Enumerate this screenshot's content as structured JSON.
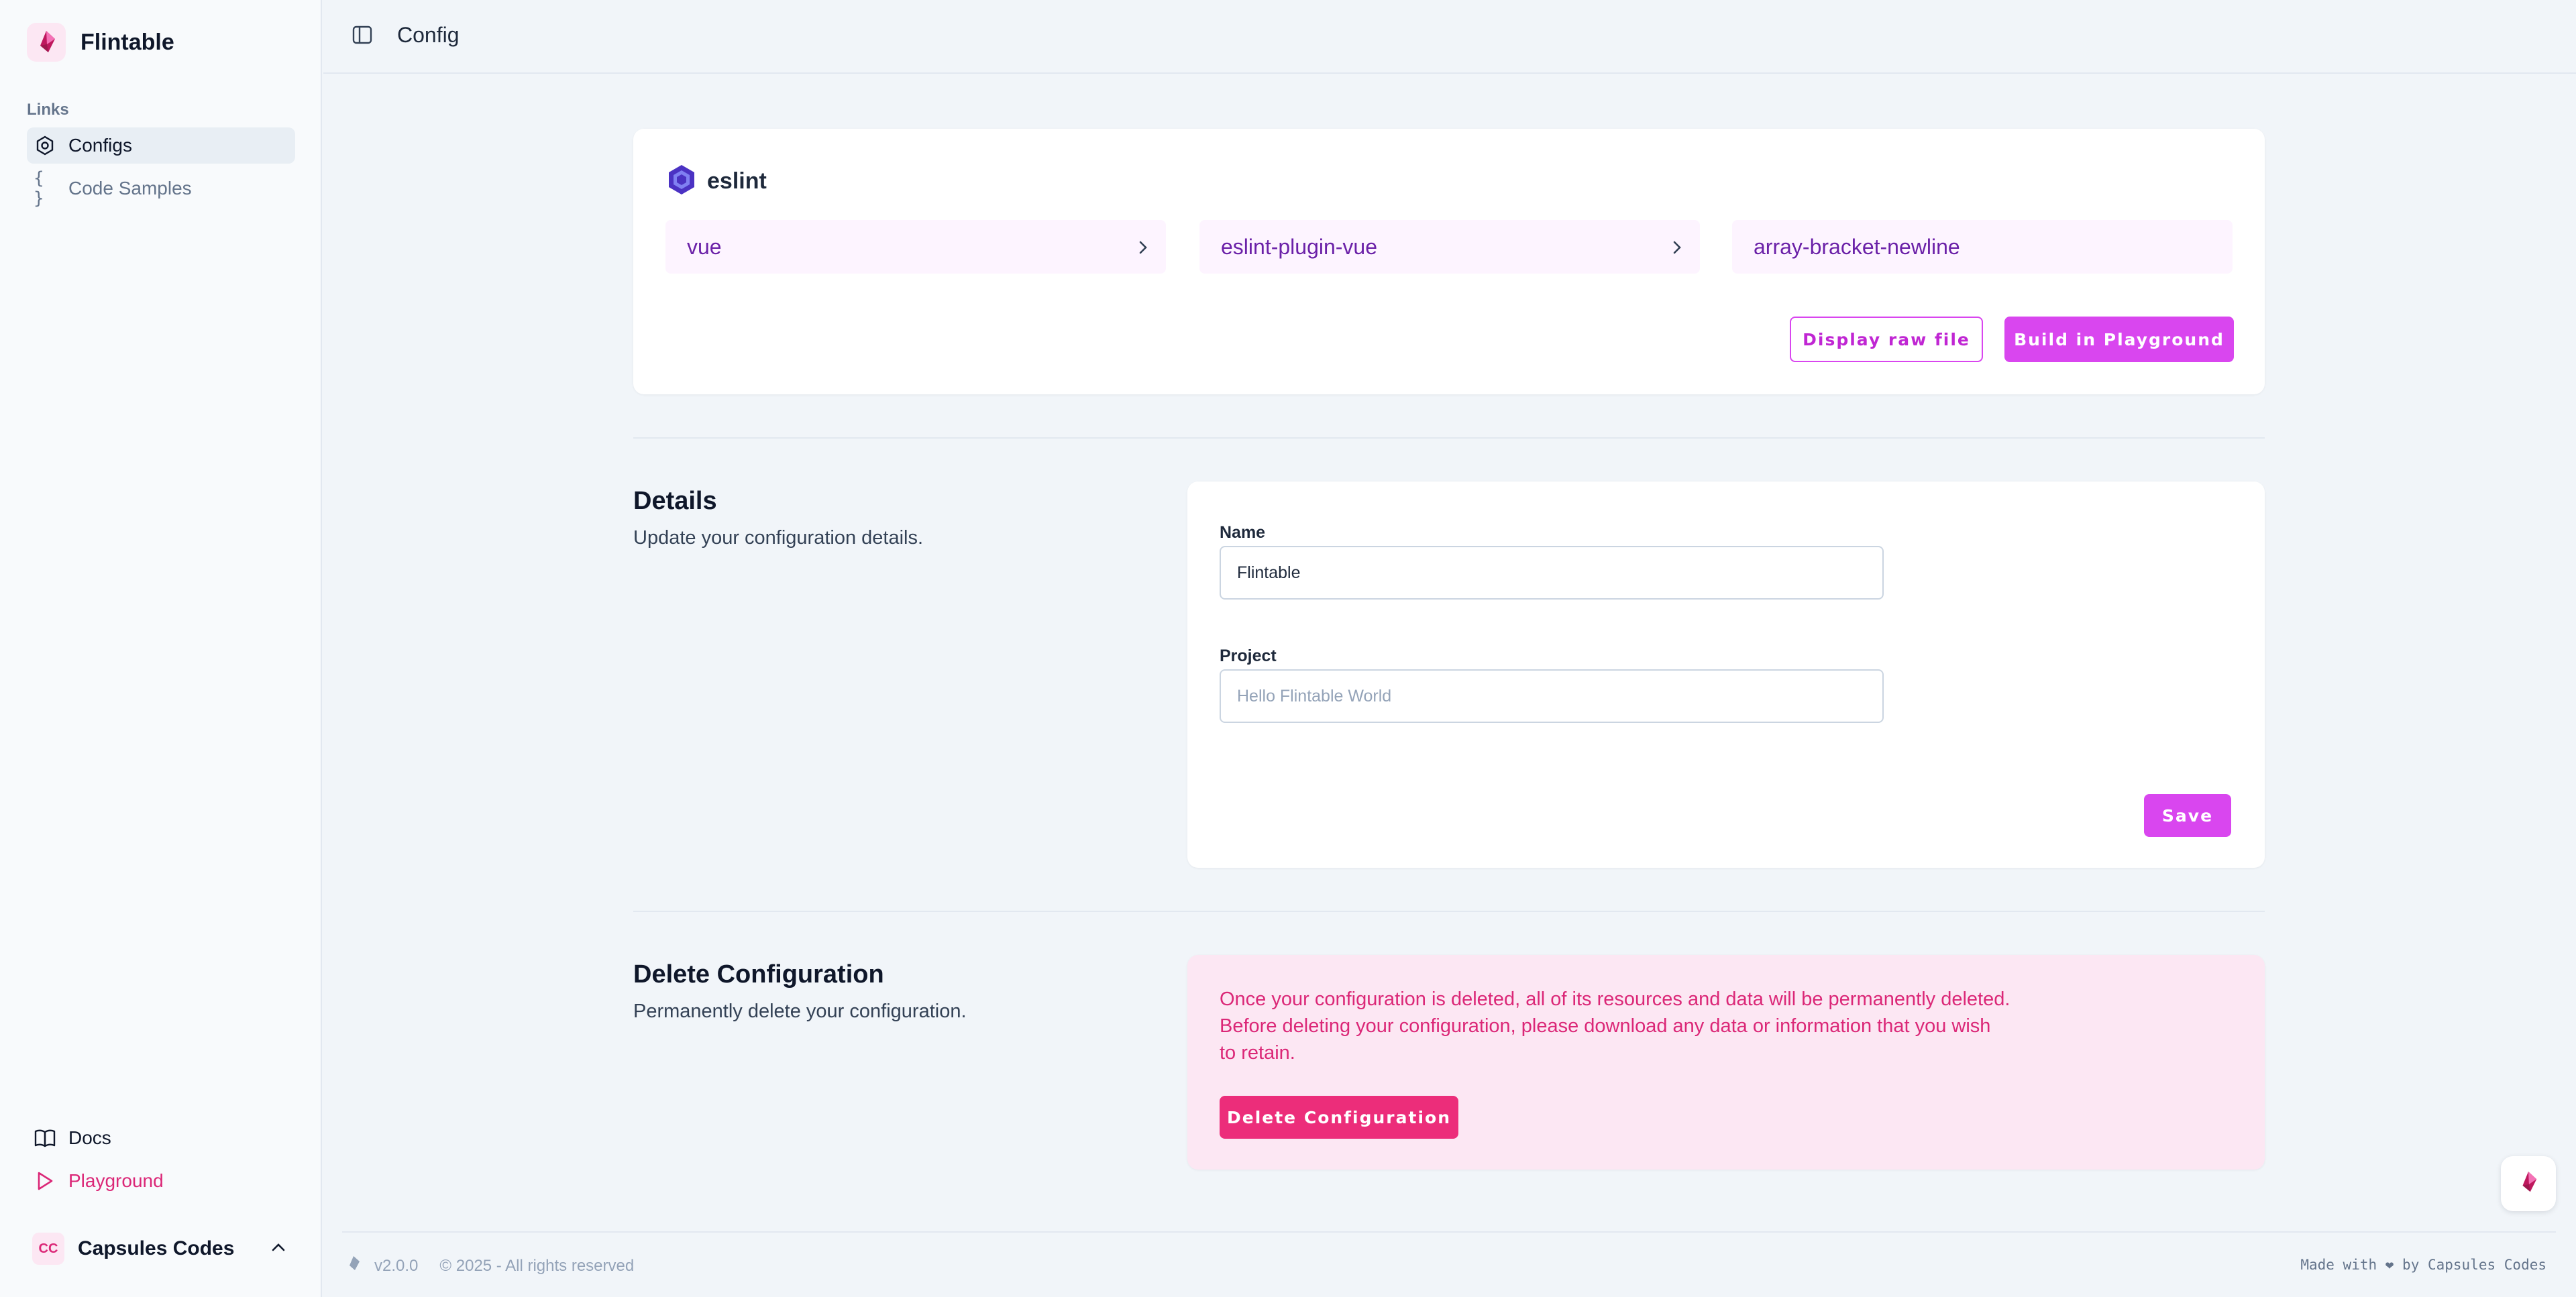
{
  "app": {
    "name": "Flintable"
  },
  "sidebar": {
    "links_label": "Links",
    "items": [
      {
        "label": "Configs",
        "icon": "hexagon-gear-icon",
        "active": true
      },
      {
        "label": "Code Samples",
        "icon": "braces-icon",
        "active": false
      }
    ],
    "bottom_items": [
      {
        "label": "Docs",
        "icon": "book-icon"
      },
      {
        "label": "Playground",
        "icon": "play-icon"
      }
    ],
    "user": {
      "initials": "CC",
      "name": "Capsules Codes"
    }
  },
  "header": {
    "title": "Config"
  },
  "config": {
    "tool": "eslint",
    "breadcrumbs": [
      "vue",
      "eslint-plugin-vue",
      "array-bracket-newline"
    ],
    "display_raw_label": "Display raw file",
    "build_label": "Build in Playground"
  },
  "details": {
    "title": "Details",
    "description": "Update your configuration details.",
    "name_label": "Name",
    "name_value": "Flintable",
    "project_label": "Project",
    "project_placeholder": "Hello Flintable World",
    "save_label": "Save"
  },
  "delete": {
    "title": "Delete Configuration",
    "description": "Permanently delete your configuration.",
    "warning": "Once your configuration is deleted, all of its resources and data will be permanently deleted. Before deleting your configuration, please download any data or information that you wish to retain.",
    "button_label": "Delete Configuration"
  },
  "footer": {
    "version": "v2.0.0",
    "copyright": "© 2025 - All rights reserved",
    "made_with": "Made with ❤ by Capsules Codes"
  },
  "colors": {
    "accent": "#d946ef",
    "danger": "#ec2d7a",
    "brand": "#db2777",
    "eslint": "#4b32c3"
  }
}
